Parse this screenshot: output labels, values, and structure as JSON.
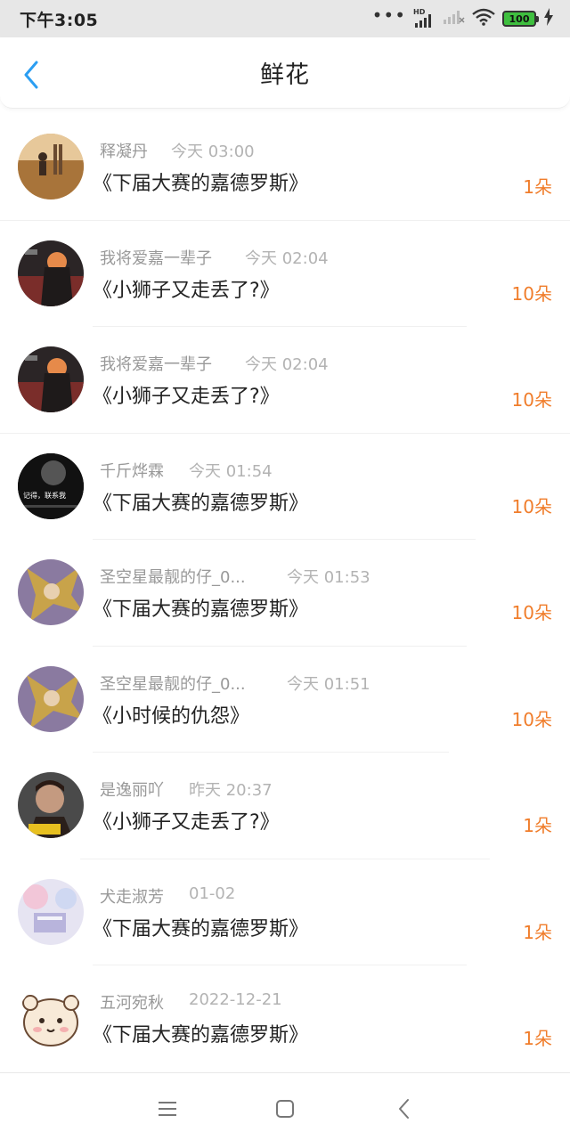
{
  "status_bar": {
    "time": "下午3:05",
    "dots": "•••",
    "hd": "HD",
    "battery": "100",
    "icons": [
      "more-dots-icon",
      "signal-icon",
      "signal-x-icon",
      "wifi-icon",
      "battery-icon",
      "charging-icon"
    ]
  },
  "nav": {
    "title": "鲜花",
    "back_icon": "chevron-left-icon",
    "accent_color": "#2b9ef2"
  },
  "colors": {
    "count": "#f07d2b",
    "name": "#999999",
    "time": "#b3b3b3"
  },
  "items": [
    {
      "name": "释凝丹",
      "time": "今天 03:00",
      "title": "《下届大赛的嘉德罗斯》",
      "count": "1朵",
      "avatar": "desert-avatar"
    },
    {
      "name": "我将爱嘉一辈子",
      "time": "今天 02:04",
      "title": "《小狮子又走丢了?》",
      "count": "10朵",
      "avatar": "anime-avatar"
    },
    {
      "name": "我将爱嘉一辈子",
      "time": "今天 02:04",
      "title": "《小狮子又走丢了?》",
      "count": "10朵",
      "avatar": "anime-avatar"
    },
    {
      "name": "千斤烨霖",
      "time": "今天 01:54",
      "title": "《下届大赛的嘉德罗斯》",
      "count": "10朵",
      "avatar": "dark-text-avatar",
      "avatar_text": "记得，联系我"
    },
    {
      "name": "圣空星最靓的仔_0...",
      "time": "今天 01:53",
      "title": "《下届大赛的嘉德罗斯》",
      "count": "10朵",
      "avatar": "anime-gold-avatar"
    },
    {
      "name": "圣空星最靓的仔_0...",
      "time": "今天 01:51",
      "title": "《小时候的仇怨》",
      "count": "10朵",
      "avatar": "anime-gold-avatar"
    },
    {
      "name": "是逸丽吖",
      "time": "昨天 20:37",
      "title": "《小狮子又走丢了?》",
      "count": "1朵",
      "avatar": "portrait-avatar"
    },
    {
      "name": "犬走淑芳",
      "time": "01-02",
      "title": "《下届大赛的嘉德罗斯》",
      "count": "1朵",
      "avatar": "pastel-avatar"
    },
    {
      "name": "五河宛秋",
      "time": "2022-12-21",
      "title": "《下届大赛的嘉德罗斯》",
      "count": "1朵",
      "avatar": "cartoon-avatar"
    }
  ],
  "bottom_nav": {
    "icons": [
      "menu-icon",
      "home-square-icon",
      "back-icon"
    ]
  }
}
